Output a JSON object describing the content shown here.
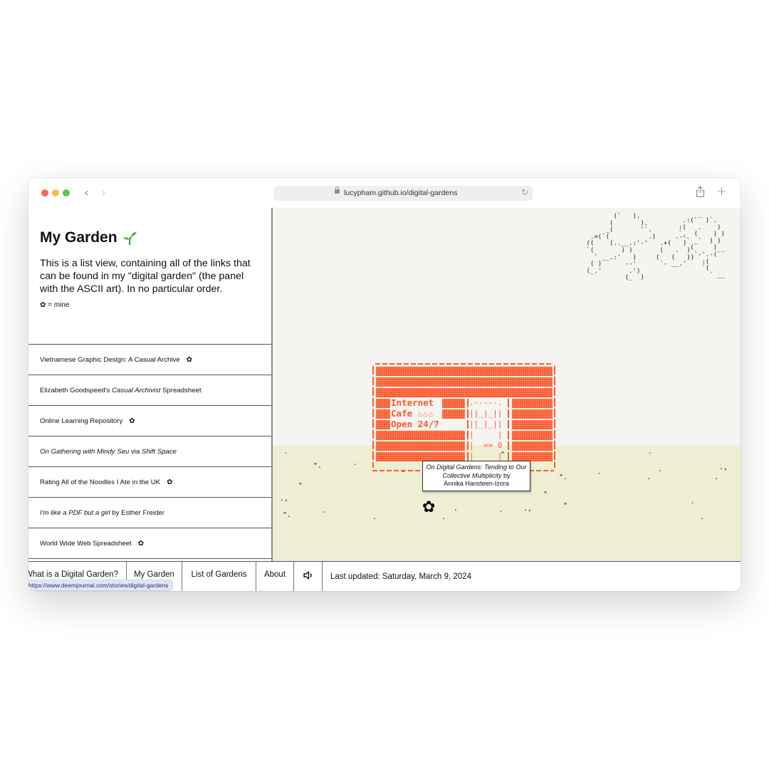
{
  "browser": {
    "url": "lucypham.github.io/digital-gardens",
    "icons": [
      "close-dot",
      "minimize-dot",
      "zoom-dot",
      "back-icon",
      "forward-icon",
      "lock-icon",
      "reload-icon",
      "share-icon",
      "new-tab-icon"
    ]
  },
  "sidebar": {
    "title": "My Garden",
    "title_emoji": "sprout",
    "description": "This is a list view, containing all of the links that can be found in my \"digital garden\" (the panel with the ASCII art). In no particular order.",
    "legend_symbol": "✿",
    "legend_text": "= mine",
    "items": [
      {
        "parts": [
          {
            "text": "Vietnamese Graphic Design: A Casual Archive",
            "italic": false
          }
        ],
        "mine": true
      },
      {
        "parts": [
          {
            "text": "Elizabeth Goodspeed's ",
            "italic": false
          },
          {
            "text": "Casual Archivist",
            "italic": true
          },
          {
            "text": " Spreadsheet",
            "italic": false
          }
        ],
        "mine": false
      },
      {
        "parts": [
          {
            "text": "Online Learning Repository",
            "italic": false
          }
        ],
        "mine": true
      },
      {
        "parts": [
          {
            "text": "On Gathering with Mindy Seu",
            "italic": true
          },
          {
            "text": " via ",
            "italic": false
          },
          {
            "text": "Shift Space",
            "italic": true
          }
        ],
        "mine": false
      },
      {
        "parts": [
          {
            "text": "Rating All of the Noodles I Ate in the UK",
            "italic": false
          }
        ],
        "mine": true
      },
      {
        "parts": [
          {
            "text": "I'm like a PDF but a girl",
            "italic": true
          },
          {
            "text": " by Esther Freider",
            "italic": false
          }
        ],
        "mine": false
      },
      {
        "parts": [
          {
            "text": "World Wide Web Spreadsheet",
            "italic": false
          }
        ],
        "mine": true
      }
    ],
    "mine_symbol": "✿"
  },
  "garden": {
    "clouds_ascii": "             (`   ).\n            (       ).  \n           _(       '`.    \n       .=(`(          .)     .--       \n      ((    (..__.:'-'   .+(   )     \n      `(       ) )       (   .  )    \n        ` __.:'   )     (   (   ))   \n       ( )      --'      `- __.'     \n      (_.'       .')                 \n                (_  )                ",
    "clouds_ascii_right": " .:(`‾ )`.  \n:(   .    ) \n`.  (    ) )\n  ` _`  ) ) \n   (     )  \n    `-'.-(`‾\n      :(    \n      `(    \n        ` __",
    "cafe_sign": [
      "Internet",
      "Cafe ♨♨♨",
      "Open 24/7"
    ],
    "door_ascii": ".-----.\n||_|_||\n||_|_||\n|     |\n|  == 0\n|     |",
    "tooltip": {
      "title_italic": "On Digital Gardens: Tending to Our Collective Multiplicity",
      "suffix": " by",
      "author": "Annika Hansteen-Izora"
    },
    "flower_symbol": "✿",
    "colors": {
      "brick": "#fb5a2e",
      "sky": "#f5f4f0",
      "ground": "#eeeed2"
    }
  },
  "footer": {
    "nav": [
      "What is a Digital Garden?",
      "My Garden",
      "List of Gardens",
      "About"
    ],
    "sound_icon": "🔈",
    "last_updated": "Last updated: Saturday, March 9, 2024",
    "status_url": "https://www.deemjournal.com/stories/digital-gardens"
  }
}
